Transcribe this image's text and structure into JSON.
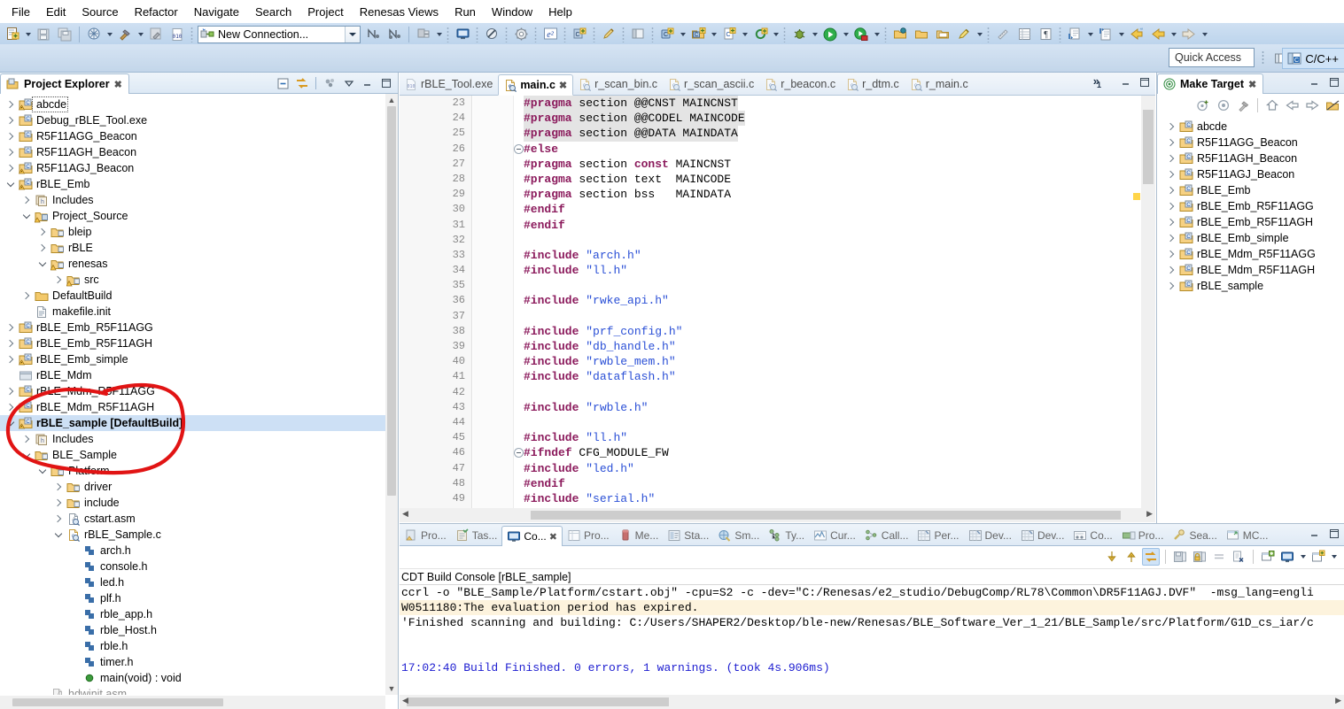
{
  "window": {
    "menu": [
      "File",
      "Edit",
      "Source",
      "Refactor",
      "Navigate",
      "Search",
      "Project",
      "Renesas Views",
      "Run",
      "Window",
      "Help"
    ],
    "quick_access_placeholder": "Quick Access",
    "perspective_label": "C/C++"
  },
  "toolbar": {
    "connection_combo_value": "New Connection...",
    "icons": [
      "new-file-icon",
      "save-icon",
      "save-all-icon",
      "link-icon",
      "build-hammer-icon",
      "build-all-icon",
      "hex-editor-icon",
      "new-connection-icon",
      "step-filter-icon",
      "step-filter2-icon",
      "debug-config-icon",
      "console-icon",
      "skip-breakpoints-icon",
      "settings-gear-icon",
      "e2-studio-icon",
      "new-c-project-icon",
      "edit-pencil-icon",
      "open-perspective-icon",
      "new-class-icon",
      "new-class-folder-icon",
      "new-source-file-icon",
      "refresh-icon",
      "debug-bug-icon",
      "run-icon",
      "run-external-icon",
      "open-folder-icon",
      "open-folder2-icon",
      "open-type-icon",
      "highlighter-icon",
      "ruler-icon",
      "table-icon",
      "pilcrow-icon",
      "next-annotation-icon",
      "previous-annotation-icon",
      "back-yellow-icon",
      "back-icon",
      "forward-icon"
    ]
  },
  "project_explorer": {
    "title": "Project Explorer",
    "view_toolbar": [
      "collapse-all-icon",
      "link-with-editor-icon",
      "view-menu-icon",
      "minimize-icon",
      "maximize-icon"
    ],
    "tree": [
      {
        "indent": 0,
        "twist": "closed",
        "icon": "c-project-warn-icon",
        "label": "abcde",
        "state": "dotted"
      },
      {
        "indent": 0,
        "twist": "closed",
        "icon": "c-project-icon",
        "label": "Debug_rBLE_Tool.exe",
        "state": ""
      },
      {
        "indent": 0,
        "twist": "closed",
        "icon": "c-project-icon",
        "label": "R5F11AGG_Beacon",
        "state": ""
      },
      {
        "indent": 0,
        "twist": "closed",
        "icon": "c-project-icon",
        "label": "R5F11AGH_Beacon",
        "state": ""
      },
      {
        "indent": 0,
        "twist": "closed",
        "icon": "c-project-warn-icon",
        "label": "R5F11AGJ_Beacon",
        "state": ""
      },
      {
        "indent": 0,
        "twist": "open",
        "icon": "c-project-warn-icon",
        "label": "rBLE_Emb",
        "state": ""
      },
      {
        "indent": 1,
        "twist": "closed",
        "icon": "includes-icon",
        "label": "Includes",
        "state": ""
      },
      {
        "indent": 1,
        "twist": "open",
        "icon": "source-folder-icon",
        "label": "Project_Source",
        "state": ""
      },
      {
        "indent": 2,
        "twist": "closed",
        "icon": "folder-icon",
        "label": "bleip",
        "state": ""
      },
      {
        "indent": 2,
        "twist": "closed",
        "icon": "folder-icon",
        "label": "rBLE",
        "state": ""
      },
      {
        "indent": 2,
        "twist": "open",
        "icon": "folder-warn-icon",
        "label": "renesas",
        "state": ""
      },
      {
        "indent": 3,
        "twist": "closed",
        "icon": "folder-warn-icon",
        "label": "src",
        "state": ""
      },
      {
        "indent": 1,
        "twist": "closed",
        "icon": "folder-build-icon",
        "label": "DefaultBuild",
        "state": ""
      },
      {
        "indent": 1,
        "twist": "none",
        "icon": "file-icon",
        "label": "makefile.init",
        "state": ""
      },
      {
        "indent": 0,
        "twist": "closed",
        "icon": "c-project-icon",
        "label": "rBLE_Emb_R5F11AGG",
        "state": ""
      },
      {
        "indent": 0,
        "twist": "closed",
        "icon": "c-project-icon",
        "label": "rBLE_Emb_R5F11AGH",
        "state": ""
      },
      {
        "indent": 0,
        "twist": "closed",
        "icon": "c-project-warn-icon",
        "label": "rBLE_Emb_simple",
        "state": ""
      },
      {
        "indent": 0,
        "twist": "none",
        "icon": "closed-project-icon",
        "label": "rBLE_Mdm",
        "state": ""
      },
      {
        "indent": 0,
        "twist": "closed",
        "icon": "c-project-icon",
        "label": "rBLE_Mdm_R5F11AGG",
        "state": ""
      },
      {
        "indent": 0,
        "twist": "closed",
        "icon": "c-project-icon",
        "label": "rBLE_Mdm_R5F11AGH",
        "state": ""
      },
      {
        "indent": 0,
        "twist": "open",
        "icon": "c-project-warn-icon",
        "label": "rBLE_sample [DefaultBuild]",
        "state": "selected"
      },
      {
        "indent": 1,
        "twist": "closed",
        "icon": "includes-icon",
        "label": "Includes",
        "state": ""
      },
      {
        "indent": 1,
        "twist": "open",
        "icon": "folder-link-icon",
        "label": "BLE_Sample",
        "state": ""
      },
      {
        "indent": 2,
        "twist": "open",
        "icon": "folder-link-icon",
        "label": "Platform",
        "state": ""
      },
      {
        "indent": 3,
        "twist": "closed",
        "icon": "folder-link-icon",
        "label": "driver",
        "state": ""
      },
      {
        "indent": 3,
        "twist": "closed",
        "icon": "folder-link-icon",
        "label": "include",
        "state": ""
      },
      {
        "indent": 3,
        "twist": "closed",
        "icon": "asm-file-icon",
        "label": "cstart.asm",
        "state": ""
      },
      {
        "indent": 3,
        "twist": "open",
        "icon": "c-file-icon",
        "label": "rBLE_Sample.c",
        "state": ""
      },
      {
        "indent": 4,
        "twist": "none",
        "icon": "header-ref-icon",
        "label": "arch.h",
        "state": ""
      },
      {
        "indent": 4,
        "twist": "none",
        "icon": "header-ref-icon",
        "label": "console.h",
        "state": ""
      },
      {
        "indent": 4,
        "twist": "none",
        "icon": "header-ref-icon",
        "label": "led.h",
        "state": ""
      },
      {
        "indent": 4,
        "twist": "none",
        "icon": "header-ref-icon",
        "label": "plf.h",
        "state": ""
      },
      {
        "indent": 4,
        "twist": "none",
        "icon": "header-ref-icon",
        "label": "rble_app.h",
        "state": ""
      },
      {
        "indent": 4,
        "twist": "none",
        "icon": "header-ref-icon",
        "label": "rble_Host.h",
        "state": ""
      },
      {
        "indent": 4,
        "twist": "none",
        "icon": "header-ref-icon",
        "label": "rble.h",
        "state": ""
      },
      {
        "indent": 4,
        "twist": "none",
        "icon": "header-ref-icon",
        "label": "timer.h",
        "state": ""
      },
      {
        "indent": 4,
        "twist": "none",
        "icon": "method-icon",
        "label": "main(void) : void",
        "state": ""
      },
      {
        "indent": 2,
        "twist": "none",
        "icon": "asm-file-grey-icon",
        "label": "hdwinit.asm",
        "state": "grey"
      }
    ]
  },
  "editor": {
    "tabs": [
      {
        "label": "r_main.c",
        "active": false,
        "icon": "c-file-icon"
      },
      {
        "label": "r_dtm.c",
        "active": false,
        "icon": "c-file-icon"
      },
      {
        "label": "r_beacon.c",
        "active": false,
        "icon": "c-file-icon"
      },
      {
        "label": "r_scan_ascii.c",
        "active": false,
        "icon": "c-file-icon"
      },
      {
        "label": "r_scan_bin.c",
        "active": false,
        "icon": "c-file-icon"
      },
      {
        "label": "main.c",
        "active": true,
        "icon": "c-file-icon"
      },
      {
        "label": "rBLE_Tool.exe",
        "active": false,
        "icon": "exe-file-icon"
      }
    ],
    "more_tabs": "»",
    "more_count": "1",
    "controls": [
      "restore-icon",
      "maximize-icon"
    ],
    "lines": [
      {
        "n": "23",
        "fold": "",
        "hl": true,
        "tokens": [
          {
            "t": "#pragma",
            "c": "pp"
          },
          {
            "t": " section @@CNST MAINCNST",
            "c": "pl"
          }
        ]
      },
      {
        "n": "24",
        "fold": "",
        "hl": true,
        "tokens": [
          {
            "t": "#pragma",
            "c": "pp"
          },
          {
            "t": " section @@CODEL MAINCODE",
            "c": "pl"
          }
        ]
      },
      {
        "n": "25",
        "fold": "",
        "hl": true,
        "tokens": [
          {
            "t": "#pragma",
            "c": "pp"
          },
          {
            "t": " section @@DATA MAINDATA",
            "c": "pl"
          }
        ]
      },
      {
        "n": "26",
        "fold": "minus",
        "hl": false,
        "tokens": [
          {
            "t": "#else",
            "c": "pp"
          }
        ]
      },
      {
        "n": "27",
        "fold": "",
        "hl": false,
        "tokens": [
          {
            "t": "#pragma",
            "c": "pp"
          },
          {
            "t": " section ",
            "c": "pl"
          },
          {
            "t": "const",
            "c": "kw"
          },
          {
            "t": " MAINCNST",
            "c": "pl"
          }
        ]
      },
      {
        "n": "28",
        "fold": "",
        "hl": false,
        "tokens": [
          {
            "t": "#pragma",
            "c": "pp"
          },
          {
            "t": " section text  MAINCODE",
            "c": "pl"
          }
        ]
      },
      {
        "n": "29",
        "fold": "",
        "hl": false,
        "tokens": [
          {
            "t": "#pragma",
            "c": "pp"
          },
          {
            "t": " section bss   MAINDATA",
            "c": "pl"
          }
        ]
      },
      {
        "n": "30",
        "fold": "",
        "hl": false,
        "tokens": [
          {
            "t": "#endif",
            "c": "pp"
          }
        ]
      },
      {
        "n": "31",
        "fold": "",
        "hl": false,
        "tokens": [
          {
            "t": "#endif",
            "c": "pp"
          }
        ]
      },
      {
        "n": "32",
        "fold": "",
        "hl": false,
        "tokens": []
      },
      {
        "n": "33",
        "fold": "",
        "hl": false,
        "tokens": [
          {
            "t": "#include",
            "c": "pp"
          },
          {
            "t": " ",
            "c": "pl"
          },
          {
            "t": "\"arch.h\"",
            "c": "str"
          }
        ]
      },
      {
        "n": "34",
        "fold": "",
        "hl": false,
        "tokens": [
          {
            "t": "#include",
            "c": "pp"
          },
          {
            "t": " ",
            "c": "pl"
          },
          {
            "t": "\"ll.h\"",
            "c": "str"
          }
        ]
      },
      {
        "n": "35",
        "fold": "",
        "hl": false,
        "tokens": []
      },
      {
        "n": "36",
        "fold": "",
        "hl": false,
        "tokens": [
          {
            "t": "#include",
            "c": "pp"
          },
          {
            "t": " ",
            "c": "pl"
          },
          {
            "t": "\"rwke_api.h\"",
            "c": "str"
          }
        ]
      },
      {
        "n": "37",
        "fold": "",
        "hl": false,
        "tokens": []
      },
      {
        "n": "38",
        "fold": "",
        "hl": false,
        "tokens": [
          {
            "t": "#include",
            "c": "pp"
          },
          {
            "t": " ",
            "c": "pl"
          },
          {
            "t": "\"prf_config.h\"",
            "c": "str"
          }
        ]
      },
      {
        "n": "39",
        "fold": "",
        "hl": false,
        "tokens": [
          {
            "t": "#include",
            "c": "pp"
          },
          {
            "t": " ",
            "c": "pl"
          },
          {
            "t": "\"db_handle.h\"",
            "c": "str"
          }
        ]
      },
      {
        "n": "40",
        "fold": "",
        "hl": false,
        "tokens": [
          {
            "t": "#include",
            "c": "pp"
          },
          {
            "t": " ",
            "c": "pl"
          },
          {
            "t": "\"rwble_mem.h\"",
            "c": "str"
          }
        ]
      },
      {
        "n": "41",
        "fold": "",
        "hl": false,
        "tokens": [
          {
            "t": "#include",
            "c": "pp"
          },
          {
            "t": " ",
            "c": "pl"
          },
          {
            "t": "\"dataflash.h\"",
            "c": "str"
          }
        ]
      },
      {
        "n": "42",
        "fold": "",
        "hl": false,
        "tokens": []
      },
      {
        "n": "43",
        "fold": "",
        "hl": false,
        "tokens": [
          {
            "t": "#include",
            "c": "pp"
          },
          {
            "t": " ",
            "c": "pl"
          },
          {
            "t": "\"rwble.h\"",
            "c": "str"
          }
        ]
      },
      {
        "n": "44",
        "fold": "",
        "hl": false,
        "tokens": []
      },
      {
        "n": "45",
        "fold": "",
        "hl": false,
        "tokens": [
          {
            "t": "#include",
            "c": "pp"
          },
          {
            "t": " ",
            "c": "pl"
          },
          {
            "t": "\"ll.h\"",
            "c": "str"
          }
        ]
      },
      {
        "n": "46",
        "fold": "minus",
        "hl": false,
        "tokens": [
          {
            "t": "#ifndef",
            "c": "pp"
          },
          {
            "t": " CFG_MODULE_FW",
            "c": "pl"
          }
        ]
      },
      {
        "n": "47",
        "fold": "",
        "hl": false,
        "tokens": [
          {
            "t": "#include",
            "c": "pp"
          },
          {
            "t": " ",
            "c": "pl"
          },
          {
            "t": "\"led.h\"",
            "c": "str"
          }
        ]
      },
      {
        "n": "48",
        "fold": "",
        "hl": false,
        "tokens": [
          {
            "t": "#endif",
            "c": "pp"
          }
        ]
      },
      {
        "n": "49",
        "fold": "",
        "hl": false,
        "tokens": [
          {
            "t": "#include",
            "c": "pp"
          },
          {
            "t": " ",
            "c": "pl"
          },
          {
            "t": "\"serial.h\"",
            "c": "str"
          }
        ]
      }
    ]
  },
  "console": {
    "tabs": [
      {
        "label": "Pro...",
        "icon": "problems-icon",
        "active": false
      },
      {
        "label": "Tas...",
        "icon": "tasks-icon",
        "active": false
      },
      {
        "label": "Co...",
        "icon": "console-icon",
        "active": true
      },
      {
        "label": "Pro...",
        "icon": "properties-icon",
        "active": false
      },
      {
        "label": "Me...",
        "icon": "memory-icon",
        "active": false
      },
      {
        "label": "Sta...",
        "icon": "stack-icon",
        "active": false
      },
      {
        "label": "Sm...",
        "icon": "smart-browser-icon",
        "active": false
      },
      {
        "label": "Ty...",
        "icon": "type-hierarchy-icon",
        "active": false
      },
      {
        "label": "Cur...",
        "icon": "current-icon",
        "active": false
      },
      {
        "label": "Call...",
        "icon": "call-hierarchy-icon",
        "active": false
      },
      {
        "label": "Per...",
        "icon": "performance-icon",
        "active": false
      },
      {
        "label": "Dev...",
        "icon": "device-icon",
        "active": false
      },
      {
        "label": "Dev...",
        "icon": "device2-icon",
        "active": false
      },
      {
        "label": "Co...",
        "icon": "code-coverage-icon",
        "active": false
      },
      {
        "label": "Pro...",
        "icon": "progress-icon",
        "active": false
      },
      {
        "label": "Sea...",
        "icon": "search-icon",
        "active": false
      },
      {
        "label": "MC...",
        "icon": "mcu-icon",
        "active": false
      }
    ],
    "toolbar_icons": [
      "scroll-down-icon",
      "scroll-up-icon",
      "scroll-lock-icon",
      "save-console-icon",
      "pin-console-icon",
      "clear-console-icon",
      "remove-console-icon",
      "open-console-icon",
      "display-console-icon",
      "new-console-icon"
    ],
    "title": "CDT Build Console [rBLE_sample]",
    "lines": [
      {
        "text": "ccrl -o \"BLE_Sample/Platform/cstart.obj\" -cpu=S2 -c -dev=\"C:/Renesas/e2_studio/DebugComp/RL78\\Common\\DR5F11AGJ.DVF\"  -msg_lang=engli",
        "style": "plain"
      },
      {
        "text": "W0511180:The evaluation period has expired.",
        "style": "warn"
      },
      {
        "text": "'Finished scanning and building: C:/Users/SHAPER2/Desktop/ble-new/Renesas/BLE_Software_Ver_1_21/BLE_Sample/src/Platform/G1D_cs_iar/c",
        "style": "plain"
      },
      {
        "text": "",
        "style": "plain"
      },
      {
        "text": "",
        "style": "plain"
      },
      {
        "text": "17:02:40 Build Finished. 0 errors, 1 warnings. (took 4s.906ms)",
        "style": "blue"
      }
    ]
  },
  "make_target": {
    "title": "Make Target",
    "toolbar_icons": [
      "new-make-target-icon",
      "build-make-target-icon",
      "hammer-icon",
      "home-icon",
      "back-arrow-icon",
      "forward-arrow-icon",
      "up-folder-icon"
    ],
    "tree": [
      {
        "label": "abcde",
        "icon": "c-project-icon"
      },
      {
        "label": "R5F11AGG_Beacon",
        "icon": "c-project-icon"
      },
      {
        "label": "R5F11AGH_Beacon",
        "icon": "c-project-icon"
      },
      {
        "label": "R5F11AGJ_Beacon",
        "icon": "c-project-icon"
      },
      {
        "label": "rBLE_Emb",
        "icon": "c-project-icon"
      },
      {
        "label": "rBLE_Emb_R5F11AGG",
        "icon": "c-project-icon"
      },
      {
        "label": "rBLE_Emb_R5F11AGH",
        "icon": "c-project-icon"
      },
      {
        "label": "rBLE_Emb_simple",
        "icon": "c-project-icon"
      },
      {
        "label": "rBLE_Mdm_R5F11AGG",
        "icon": "c-project-icon"
      },
      {
        "label": "rBLE_Mdm_R5F11AGH",
        "icon": "c-project-icon"
      },
      {
        "label": "rBLE_sample",
        "icon": "c-project-icon"
      }
    ]
  },
  "annotation": {
    "color": "#e11414",
    "shape": "hand-drawn-ellipse-around-rBLE_sample"
  }
}
